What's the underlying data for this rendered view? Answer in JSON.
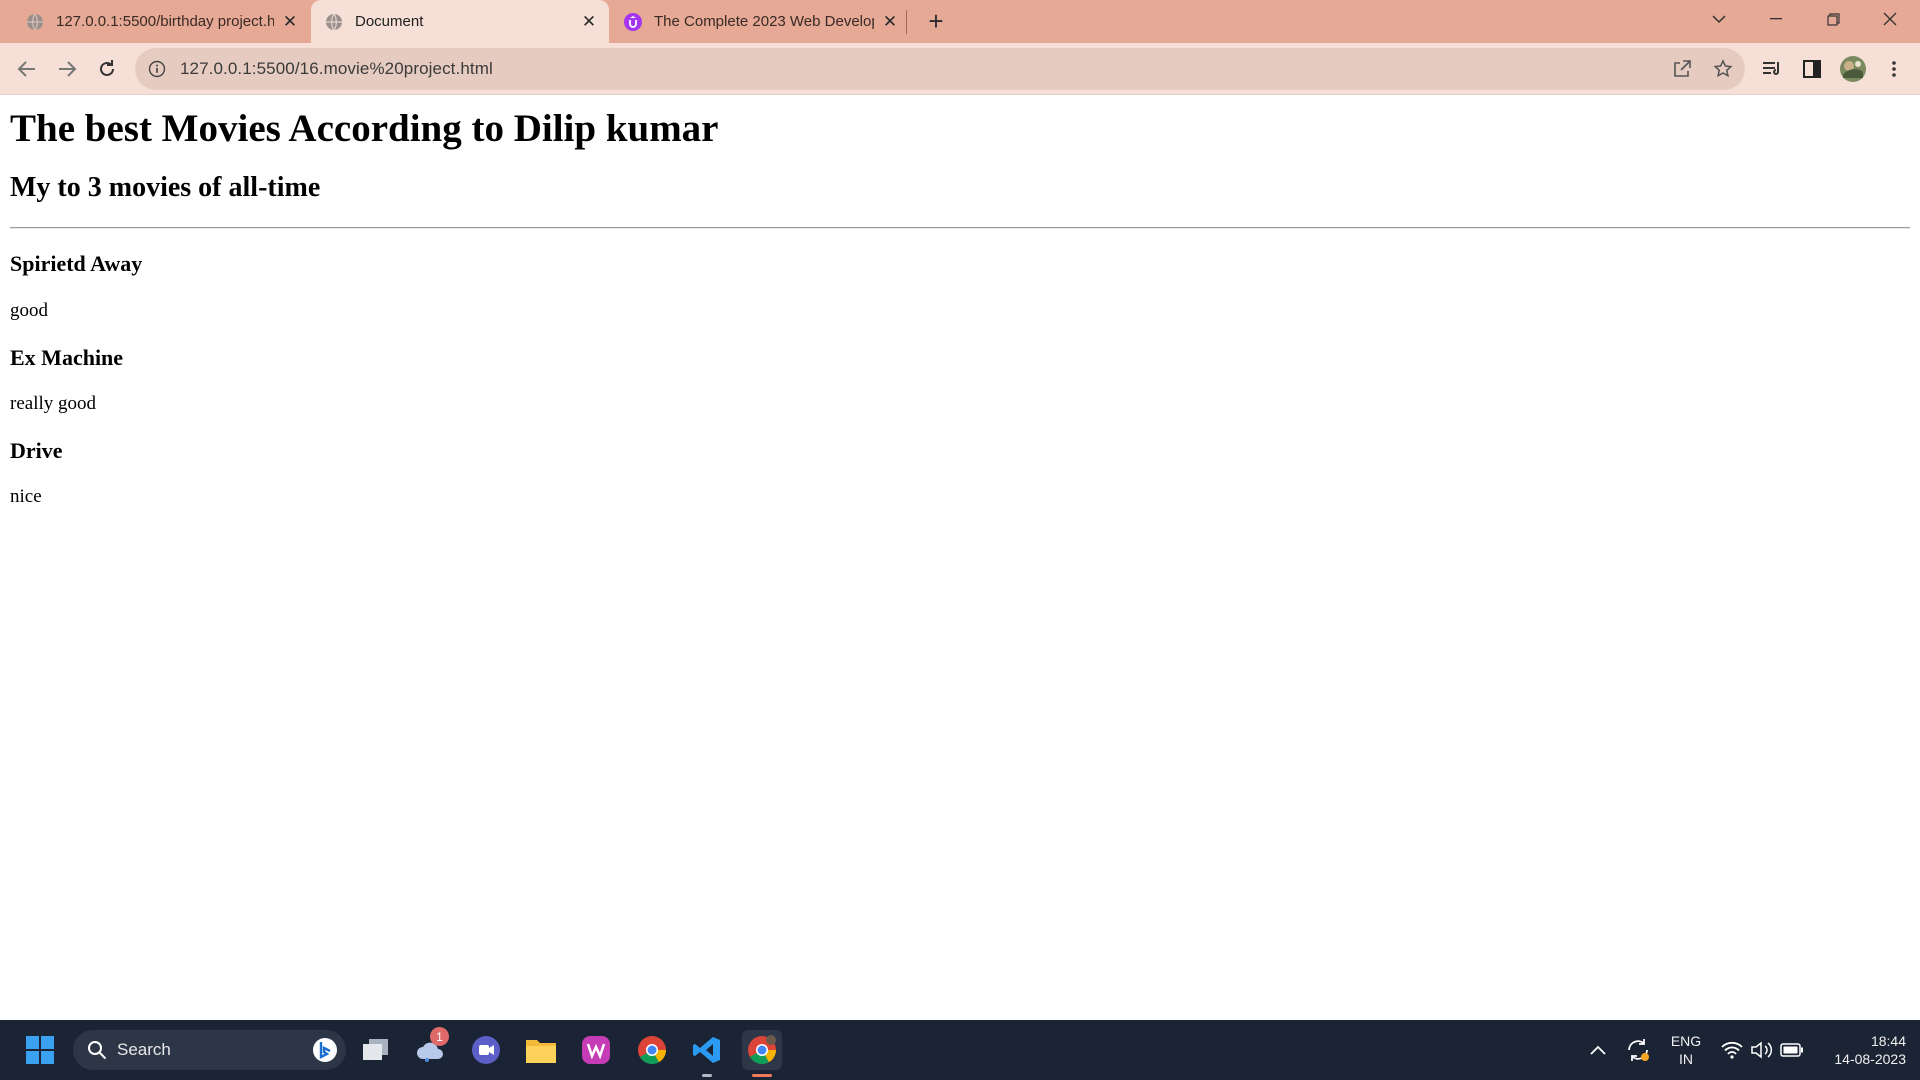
{
  "browser": {
    "tabs": [
      {
        "title": "127.0.0.1:5500/birthday project.h",
        "close_icon": "close-icon",
        "favicon": "globe-icon"
      },
      {
        "title": "Document",
        "close_icon": "close-icon",
        "favicon": "globe-icon",
        "active": true
      },
      {
        "title": "The Complete 2023 Web Develop",
        "close_icon": "close-icon",
        "favicon": "udemy-icon"
      }
    ],
    "url": "127.0.0.1:5500/16.movie%20project.html",
    "accent": "#e5a995",
    "toolbar_bg": "#f6dfd6"
  },
  "page": {
    "h1": "The best Movies According to Dilip kumar",
    "h2": "My to 3 movies of all-time",
    "movies": [
      {
        "title": "Spirietd Away",
        "review": "good"
      },
      {
        "title": "Ex Machine",
        "review": "really good"
      },
      {
        "title": "Drive",
        "review": "nice"
      }
    ]
  },
  "taskbar": {
    "search_label": "Search",
    "notification_count": "1",
    "language": "ENG",
    "region": "IN",
    "time": "18:44",
    "date": "14-08-2023"
  }
}
